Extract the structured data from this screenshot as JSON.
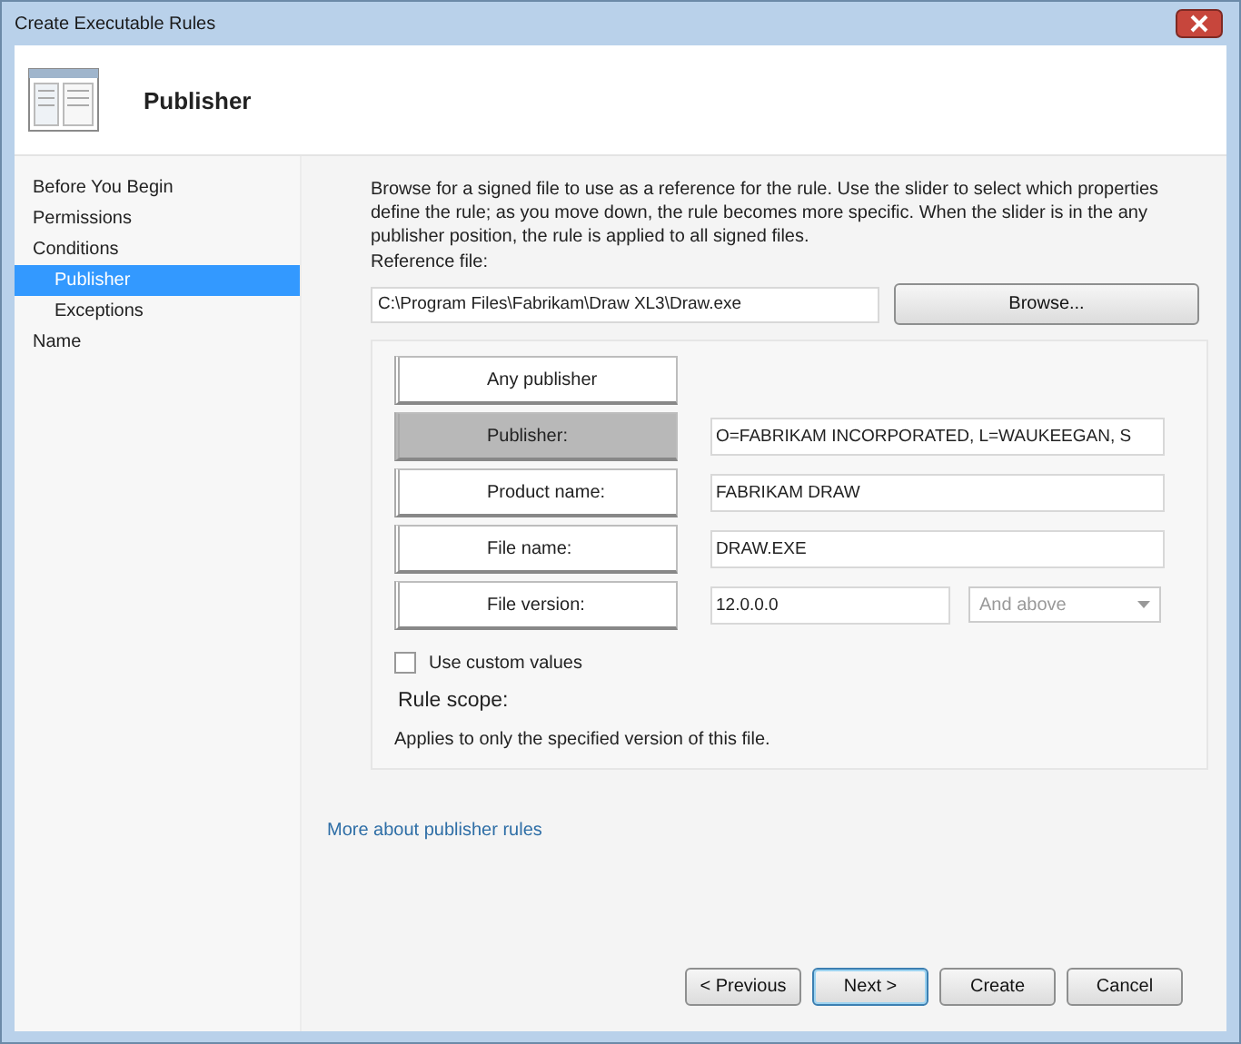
{
  "window": {
    "title": "Create Executable Rules"
  },
  "header": {
    "title": "Publisher"
  },
  "sidebar": {
    "items": [
      {
        "label": "Before You Begin",
        "selected": false
      },
      {
        "label": "Permissions",
        "selected": false
      },
      {
        "label": "Conditions",
        "selected": false,
        "children": [
          {
            "label": "Publisher",
            "selected": true
          },
          {
            "label": "Exceptions",
            "selected": false
          }
        ]
      },
      {
        "label": "Name",
        "selected": false
      }
    ]
  },
  "description": "Browse for a signed file to use as a reference for the rule. Use the slider to select which properties define the rule; as you move down, the rule becomes more specific. When the slider is in the any publisher position, the rule is applied to all signed files.",
  "reference_file": {
    "label": "Reference file:",
    "value": "C:\\Program Files\\Fabrikam\\Draw XL3\\Draw.exe",
    "button": "Browse..."
  },
  "slider": [
    {
      "label": "Any publisher",
      "selected": false
    },
    {
      "label": "Publisher:",
      "selected": true,
      "value": "O=FABRIKAM INCORPORATED, L=WAUKEEGAN, S"
    },
    {
      "label": "Product name:",
      "selected": false,
      "value": "FABRIKAM DRAW"
    },
    {
      "label": "File name:",
      "selected": false,
      "value": "DRAW.EXE"
    },
    {
      "label": "File version:",
      "selected": false,
      "value": "12.0.0.0",
      "dropdown": {
        "value": "And above",
        "disabled": true
      }
    }
  ],
  "custom_values": {
    "label": "Use custom values",
    "checked": false
  },
  "rule_scope": {
    "label": "Rule scope:",
    "text": "Applies to only the specified version of this file."
  },
  "link": "More about publisher rules",
  "buttons": [
    {
      "label": "< Previous",
      "default": false
    },
    {
      "label": "Next >",
      "default": true
    },
    {
      "label": "Create",
      "default": false
    },
    {
      "label": "Cancel",
      "default": false
    }
  ]
}
